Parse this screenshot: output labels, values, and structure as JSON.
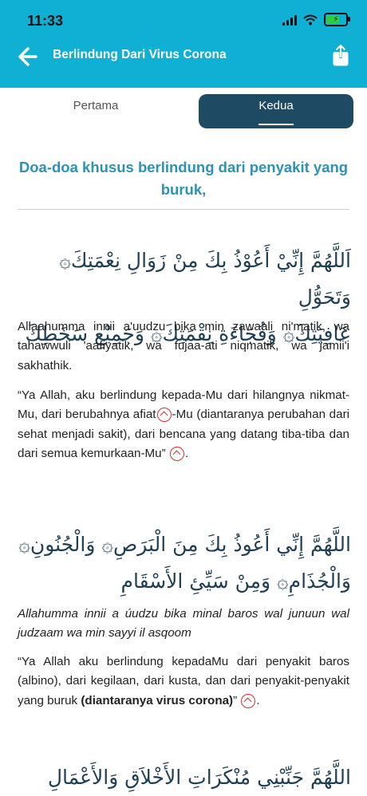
{
  "status": {
    "time": "11:33"
  },
  "header": {
    "title": "Berlindung Dari Virus Corona",
    "back_icon": "arrow-left-icon",
    "share_icon": "share-icon",
    "bar_color": "#0fb0d4"
  },
  "tabs": [
    {
      "label": "Pertama",
      "active": false
    },
    {
      "label": "Kedua",
      "active": true
    }
  ],
  "section": {
    "heading": "Doa-doa khusus berlindung dari penyakit yang buruk,"
  },
  "duas": [
    {
      "arabic_line1": "اَللَّهُمَّ إِنِّيْ أَعُوْذُ بِكَ مِنْ زَوَالِ نِعْمَتِكَ۞ وَتَحَوُّلِ",
      "arabic_line2": "عَافِيَتِكَ۞ وَفُجَاءَةِ نِقْمَتِكَ۞ وَجَمِيْعِ سَخَطِكَ",
      "latin": "Allaahumma innii a'uudzu bika min zawaali ni'matik, wa tahawwuli 'aafiyatik, wa fujaa-ati niqmatik, wa jamii'i sakhathik.",
      "translation_a": "“Ya Allah, aku berlindung kepada-Mu dari hilangnya nikmat-Mu, dari berubahnya afiat",
      "translation_b": "-Mu (diantaranya perubahan dari sehat menjadi sakit), dari bencana yang datang tiba-tiba dan dari semua kemurkaan-Mu”",
      "translation_end": "."
    },
    {
      "arabic_line1": "اللَّهُمَّ إِنِّي أَعُوذُ بِكَ مِنَ الْبَرَصِ۞ وَالْجُنُونِ۞",
      "arabic_line2": "وَالْجُذَامِ۞ وَمِنْ سَيِّئِ الأَسْقَامِ",
      "latin": "Allahumma innii a úudzu bika minal baros wal junuun wal judzaam wa min sayyi il asqoom",
      "translation_a": "“Ya Allah aku berlindung kepadaMu dari penyakit baros (albino), dari kegilaan, dari kusta, dan dari penyakit-penyakit yang buruk ",
      "translation_bold": "(diantaranya virus corona)",
      "translation_b": "”",
      "translation_end": "."
    },
    {
      "arabic_line1": "اللَّهُمَّ جَنِّبْنِي مُنْكَرَاتِ الأَخْلاَقِ وَالأَعْمَالِ"
    }
  ]
}
